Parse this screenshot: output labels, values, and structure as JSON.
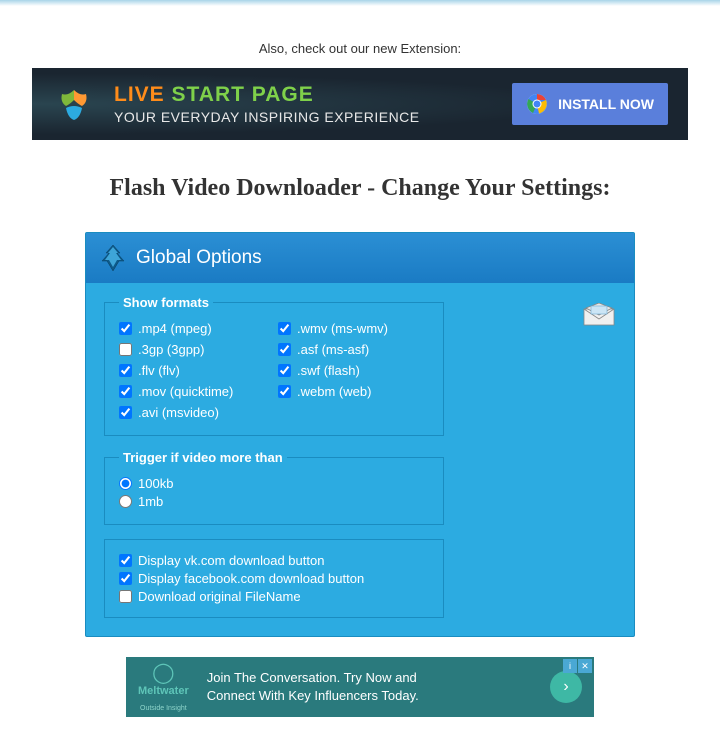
{
  "promo_text": "Also, check out our new Extension:",
  "banner": {
    "title_live": "LIVE",
    "title_rest": "START PAGE",
    "subtitle": "YOUR EVERYDAY INSPIRING EXPERIENCE",
    "install_label": "INSTALL NOW"
  },
  "page_title": "Flash Video Downloader - Change Your Settings:",
  "panel": {
    "title": "Global Options",
    "formats_legend": "Show formats",
    "formats": [
      {
        "label": ".mp4 (mpeg)",
        "checked": true
      },
      {
        "label": ".wmv (ms-wmv)",
        "checked": true
      },
      {
        "label": ".3gp (3gpp)",
        "checked": false
      },
      {
        "label": ".asf (ms-asf)",
        "checked": true
      },
      {
        "label": ".flv (flv)",
        "checked": true
      },
      {
        "label": ".swf (flash)",
        "checked": true
      },
      {
        "label": ".mov (quicktime)",
        "checked": true
      },
      {
        "label": ".webm (web)",
        "checked": true
      },
      {
        "label": ".avi (msvideo)",
        "checked": true
      }
    ],
    "trigger_legend": "Trigger if video more than",
    "triggers": [
      {
        "label": "100kb",
        "checked": true
      },
      {
        "label": "1mb",
        "checked": false
      }
    ],
    "misc": [
      {
        "label": "Display vk.com download button",
        "checked": true
      },
      {
        "label": "Display facebook.com download button",
        "checked": true
      },
      {
        "label": "Download original FileName",
        "checked": false
      }
    ]
  },
  "ad": {
    "brand": "Meltwater",
    "brand_sub": "Outside Insight",
    "line1": "Join The Conversation. Try Now and",
    "line2": "Connect With Key Influencers Today."
  }
}
